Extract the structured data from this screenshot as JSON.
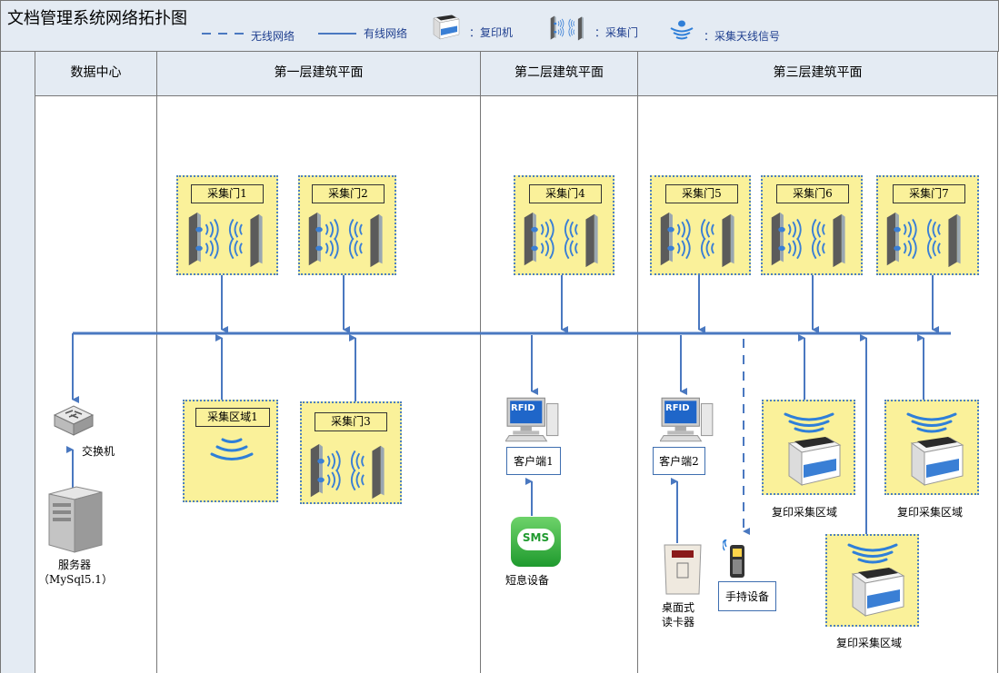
{
  "title": "文档管理系统网络拓扑图",
  "legend": {
    "wireless": "无线网络",
    "wired": "有线网络",
    "copier": "：复印机",
    "gate": "：采集门",
    "antenna": "：采集天线信号"
  },
  "columns": [
    "数据中心",
    "第一层建筑平面",
    "第二层建筑平面",
    "第三层建筑平面"
  ],
  "gates": [
    "采集门1",
    "采集门2",
    "采集门4",
    "采集门5",
    "采集门6",
    "采集门7",
    "采集门3"
  ],
  "area1": "采集区域1",
  "switch_label": "交换机",
  "server_label": "服务器",
  "server_sub": "（MySql5.1）",
  "client1": "客户端1",
  "client2": "客户端2",
  "rfid": "RFID",
  "sms_icon_text": "SMS",
  "sms_label": "短息设备",
  "desk_reader_label_1": "桌面式",
  "desk_reader_label_2": "读卡器",
  "handheld_label": "手持设备",
  "copy_area": "复印采集区域",
  "colors": {
    "line": "#4a78c0",
    "zone": "#faf19a",
    "header": "#e4ebf3"
  }
}
